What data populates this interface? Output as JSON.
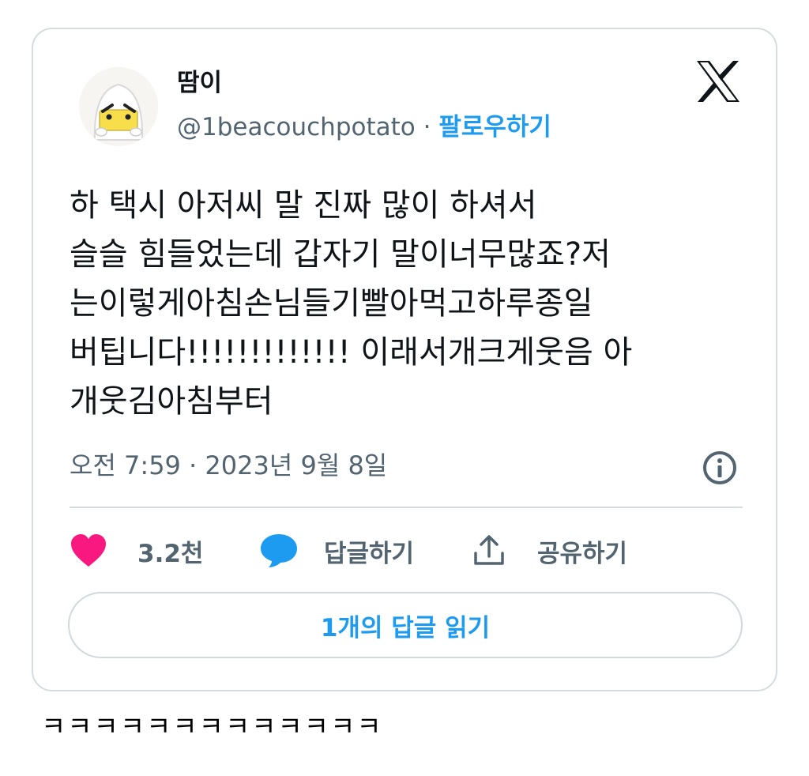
{
  "tweet": {
    "display_name": "땀이",
    "handle": "@1beacouchpotato",
    "separator": " · ",
    "follow_label": "팔로우하기",
    "text": "하 택시 아저씨 말 진짜 많이 하셔서\n슬슬 힘들었는데 갑자기 말이너무많죠?저\n는이렇게아침손님들기빨아먹고하루종일\n버팁니다!!!!!!!!!!!!!  이래서개크게웃음  아\n개웃김아침부터",
    "timestamp": "오전 7:59 · 2023년 9월 8일"
  },
  "actions": {
    "like_count": "3.2천",
    "reply_label": "답글하기",
    "share_label": "공유하기"
  },
  "replies_button_label": "1개의 답글 읽기",
  "caption": "ㅋㅋㅋㅋㅋㅋㅋㅋㅋㅋㅋㅋㅋ",
  "icons": {
    "avatar": "avatar-ghost-icon",
    "brand": "x-logo-icon",
    "info": "info-icon",
    "like": "heart-icon",
    "reply": "speech-bubble-icon",
    "share": "share-upload-icon"
  },
  "colors": {
    "link_blue": "#1d9bf0",
    "like_pink": "#f91880",
    "secondary_text": "#536471",
    "border": "#d6dbe0"
  }
}
